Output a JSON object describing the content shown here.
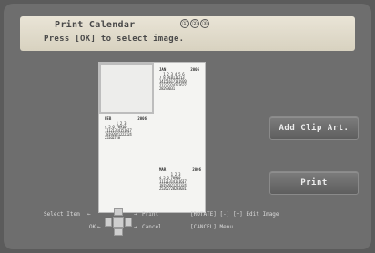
{
  "header": {
    "title": "Print Calendar",
    "subtitle": "Press [OK] to select image.",
    "mode_icons": [
      "①",
      "②",
      "③"
    ]
  },
  "preview": {
    "calendar_1": {
      "month": "2006",
      "label": "JAN",
      "rows": [
        "  1 2 3 4 5 6",
        "7 8 910111213",
        "14151617181920",
        "21222324252627",
        "28293031"
      ]
    },
    "calendar_2": {
      "month": "2006",
      "label": "FEB",
      "rows": [
        "      1 2 3",
        "4 5 6 78910",
        "11121314151617",
        "18192021222324",
        "25262728"
      ]
    },
    "calendar_3": {
      "month": "2006",
      "label": "MAR",
      "rows": [
        "      1 2 3",
        "4 5 6 78910",
        "11121314151617",
        "18192021222324",
        "25262728293031"
      ]
    }
  },
  "buttons": {
    "add_clip_art": "Add Clip Art.",
    "print": "Print"
  },
  "footer": {
    "select_item": "Select Item",
    "ok": "OK",
    "print": "Print",
    "cancel": "Cancel",
    "rotate": "[ROTATE] [-] [+] Edit Image",
    "menu": "[CANCEL] Menu"
  }
}
